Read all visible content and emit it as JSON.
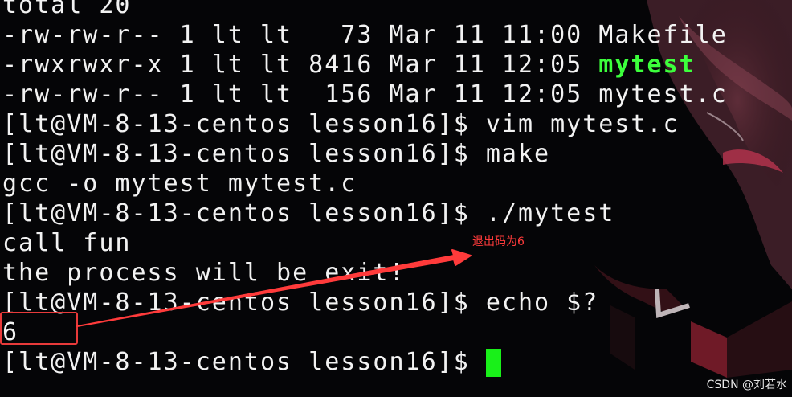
{
  "terminal": {
    "lines": {
      "l0": "total 20",
      "l1": "-rw-rw-r-- 1 lt lt   73 Mar 11 11:00 Makefile",
      "l2_prefix": "-rwxrwxr-x 1 lt lt 8416 Mar 11 12:05 ",
      "l2_name": "mytest",
      "l3": "-rw-rw-r-- 1 lt lt  156 Mar 11 12:05 mytest.c",
      "l4": "[lt@VM-8-13-centos lesson16]$ vim mytest.c",
      "l5": "[lt@VM-8-13-centos lesson16]$ make",
      "l6": "gcc -o mytest mytest.c",
      "l7": "[lt@VM-8-13-centos lesson16]$ ./mytest",
      "l8": "call fun",
      "l9": "the process will be exit!",
      "l10": "[lt@VM-8-13-centos lesson16]$ echo $?",
      "l11": "6",
      "l12_prompt": "[lt@VM-8-13-centos lesson16]$ "
    }
  },
  "annotation": {
    "text": "退出码为6",
    "color": "#ff3b3b"
  },
  "watermark": "CSDN @刘若水",
  "colors": {
    "background": "#050507",
    "text": "#f2f2f2",
    "executable": "#3cff3c",
    "cursor": "#19f019"
  }
}
